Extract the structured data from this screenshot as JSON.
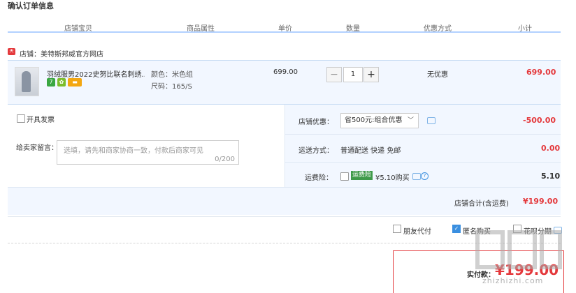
{
  "page": {
    "title": "确认订单信息"
  },
  "columns": [
    "店铺宝贝",
    "商品属性",
    "单价",
    "数量",
    "优惠方式",
    "小计"
  ],
  "shop": {
    "icon_text": "天猫",
    "label": "店铺：美特斯邦威官方网店"
  },
  "item": {
    "name": "羽绒服男2022史努比联名刺绣...",
    "badges": [
      {
        "text": "7",
        "color": "#3aa742",
        "icon": "seven-day-return-icon"
      },
      {
        "text": "✿",
        "color": "#7cbd2b",
        "icon": "flower-badge-icon"
      },
      {
        "text": "▬",
        "color": "#f3a712",
        "icon": "card-badge-icon"
      }
    ],
    "color_attr": "颜色：米色组",
    "size_attr": "尺码：165/S",
    "price": "699.00",
    "qty_minus": "−",
    "qty": "1",
    "qty_plus": "+",
    "discount": "无优惠",
    "subtotal": "699.00"
  },
  "invoice": {
    "label": "开具发票"
  },
  "message": {
    "label": "给卖家留言：",
    "placeholder": "选填，请先和商家协商一致，付款后商家可见",
    "counter": "0/200"
  },
  "shop_discount": {
    "label": "店铺优惠：",
    "selected": "省500元:组合优惠",
    "amount": "-500.00"
  },
  "shipping": {
    "label": "运送方式：",
    "value": "普通配送 快递 免邮",
    "amount": "0.00"
  },
  "insurance": {
    "label": "运费险：",
    "badge": "运费险",
    "price_text": "¥5.10购买",
    "help": "?",
    "amount": "5.10"
  },
  "shop_total": {
    "label": "店铺合计(含运费)",
    "amount": "¥199.00"
  },
  "options": {
    "friend_pay": "朋友代付",
    "anonymous": "匿名购买",
    "huabei": "花呗分期"
  },
  "payment": {
    "label": "实付款：",
    "amount": "¥199.00"
  },
  "watermark": {
    "text": "zhizhizhi.com"
  }
}
